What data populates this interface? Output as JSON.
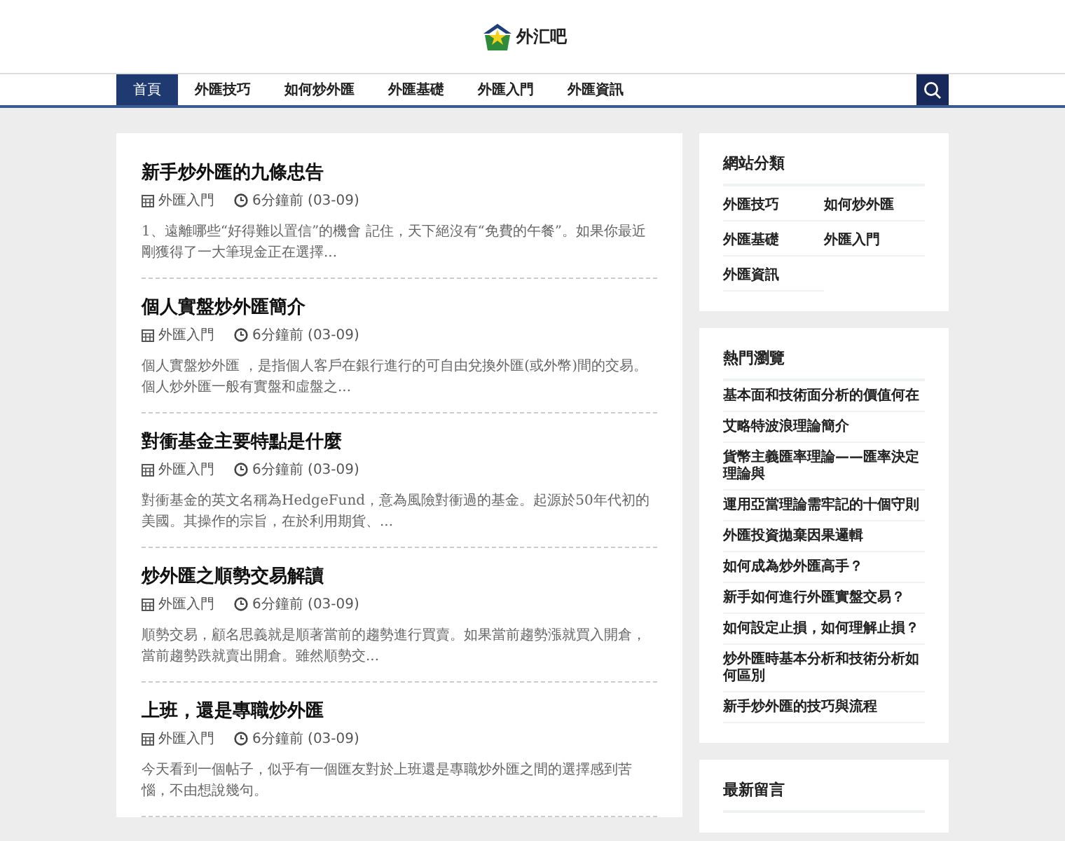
{
  "site": {
    "name": "外汇吧"
  },
  "nav": [
    {
      "label": "首頁",
      "selected": true
    },
    {
      "label": "外匯技巧",
      "selected": false
    },
    {
      "label": "如何炒外匯",
      "selected": false
    },
    {
      "label": "外匯基礎",
      "selected": false
    },
    {
      "label": "外匯入門",
      "selected": false
    },
    {
      "label": "外匯資訊",
      "selected": false
    }
  ],
  "articles": [
    {
      "title": "新手炒外匯的九條忠告",
      "category": "外匯入門",
      "time": "6分鐘前 (03-09)",
      "excerpt": "1、遠離哪些“好得難以置信”的機會 記住，天下絕沒有“免費的午餐”。如果你最近剛獲得了一大筆現金正在選擇..."
    },
    {
      "title": "個人實盤炒外匯簡介",
      "category": "外匯入門",
      "time": "6分鐘前 (03-09)",
      "excerpt": "個人實盤炒外匯 ，是指個人客戶在銀行進行的可自由兌換外匯(或外幣)間的交易。個人炒外匯一般有實盤和虛盤之..."
    },
    {
      "title": "對衝基金主要特點是什麼",
      "category": "外匯入門",
      "time": "6分鐘前 (03-09)",
      "excerpt": "對衝基金的英文名稱為HedgeFund，意為風險對衝過的基金。起源於50年代初的美國。其操作的宗旨，在於利用期貨、..."
    },
    {
      "title": "炒外匯之順勢交易解讀",
      "category": "外匯入門",
      "time": "6分鐘前 (03-09)",
      "excerpt": "順勢交易，顧名思義就是順著當前的趨勢進行買賣。如果當前趨勢漲就買入開倉，當前趨勢跌就賣出開倉。雖然順勢交..."
    },
    {
      "title": "上班，還是專職炒外匯",
      "category": "外匯入門",
      "time": "6分鐘前 (03-09)",
      "excerpt": "今天看到一個帖子，似乎有一個匯友對於上班還是專職炒外匯之間的選擇感到苦惱，不由想說幾句。"
    }
  ],
  "sidebar": [
    {
      "kind": "grid",
      "title": "網站分類",
      "items": [
        "外匯技巧",
        "如何炒外匯",
        "外匯基礎",
        "外匯入門",
        "外匯資訊"
      ]
    },
    {
      "kind": "list",
      "title": "熱門瀏覽",
      "items": [
        "基本面和技術面分析的價值何在",
        "艾略特波浪理論簡介",
        "貨幣主義匯率理論——匯率決定理論與",
        "運用亞當理論需牢記的十個守則",
        "外匯投資拋棄因果邏輯",
        "如何成為炒外匯高手？",
        "新手如何進行外匯實盤交易？",
        "如何設定止損，如何理解止損？",
        "炒外匯時基本分析和技術分析如何區別",
        "新手炒外匯的技巧與流程"
      ]
    },
    {
      "kind": "list",
      "title": "最新留言"
    }
  ]
}
